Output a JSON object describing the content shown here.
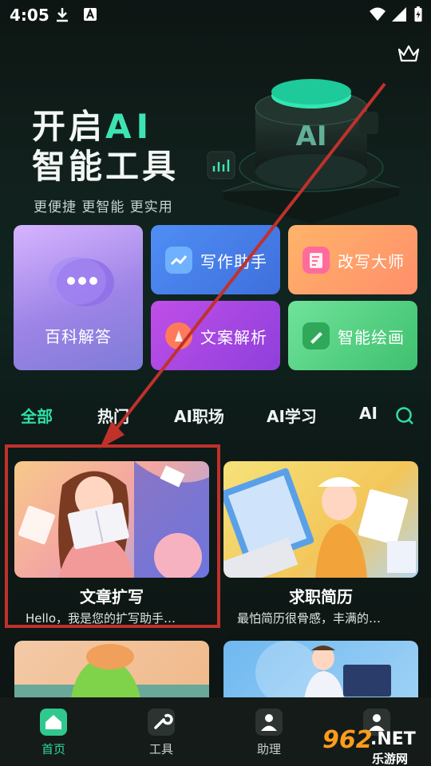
{
  "status": {
    "time": "4:05"
  },
  "hero": {
    "line1_pre": "开启",
    "line1_ai": "AI",
    "line2": "智能工具",
    "subtitle": "更便捷  更智能  更实用"
  },
  "tools": [
    {
      "label": "百科解答",
      "icon": "chat-bubble-icon"
    },
    {
      "label": "写作助手",
      "icon": "chart-icon"
    },
    {
      "label": "改写大师",
      "icon": "edit-doc-icon"
    },
    {
      "label": "文案解析",
      "icon": "pen-icon"
    },
    {
      "label": "智能绘画",
      "icon": "brush-icon"
    }
  ],
  "tabs": [
    "全部",
    "热门",
    "AI职场",
    "AI学习",
    "AI"
  ],
  "cards": [
    {
      "title": "文章扩写",
      "desc": "Hello，我是您的扩写助手…"
    },
    {
      "title": "求职简历",
      "desc": "最怕简历很骨感，丰满的…"
    }
  ],
  "nav": [
    {
      "label": "首页",
      "icon": "home-icon"
    },
    {
      "label": "工具",
      "icon": "wrench-icon"
    },
    {
      "label": "助理",
      "icon": "assistant-icon"
    },
    {
      "label": "",
      "icon": "profile-icon"
    }
  ],
  "watermark": {
    "num": "962",
    "suffix": ".NET",
    "cn": "乐游网"
  },
  "colors": {
    "accent": "#2fe0a6",
    "highlight": "#c0312b",
    "arrow": "#c0312b"
  }
}
